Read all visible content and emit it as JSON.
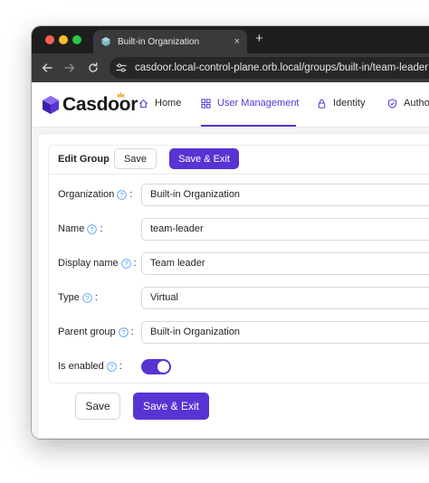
{
  "browser": {
    "tab_title": "Built-in Organization",
    "tab_close": "×",
    "new_tab": "+",
    "url": "casdoor.local-control-plane.orb.local/groups/built-in/team-leader"
  },
  "app": {
    "logo_text": "Casdoor",
    "brand_color": "#5734d3",
    "menu": [
      {
        "label": "Home",
        "icon": "home-icon"
      },
      {
        "label": "User Management",
        "icon": "grid-icon",
        "active": true
      },
      {
        "label": "Identity",
        "icon": "lock-icon"
      },
      {
        "label": "Autho",
        "icon": "shield-icon"
      }
    ]
  },
  "form": {
    "title": "Edit Group",
    "save_label": "Save",
    "save_exit_label": "Save & Exit",
    "fields": [
      {
        "label": "Organization",
        "suffix": ":",
        "value": "Built-in Organization"
      },
      {
        "label": "Name",
        "suffix": ":",
        "value": "team-leader"
      },
      {
        "label": "Display name",
        "suffix": ":",
        "value": "Team leader"
      },
      {
        "label": "Type",
        "suffix": ":",
        "value": "Virtual"
      },
      {
        "label": "Parent group",
        "suffix": ":",
        "value": "Built-in Organization"
      },
      {
        "label": "Is enabled",
        "suffix": ":",
        "value": true
      }
    ],
    "bottom_save_label": "Save",
    "bottom_save_exit_label": "Save & Exit"
  }
}
